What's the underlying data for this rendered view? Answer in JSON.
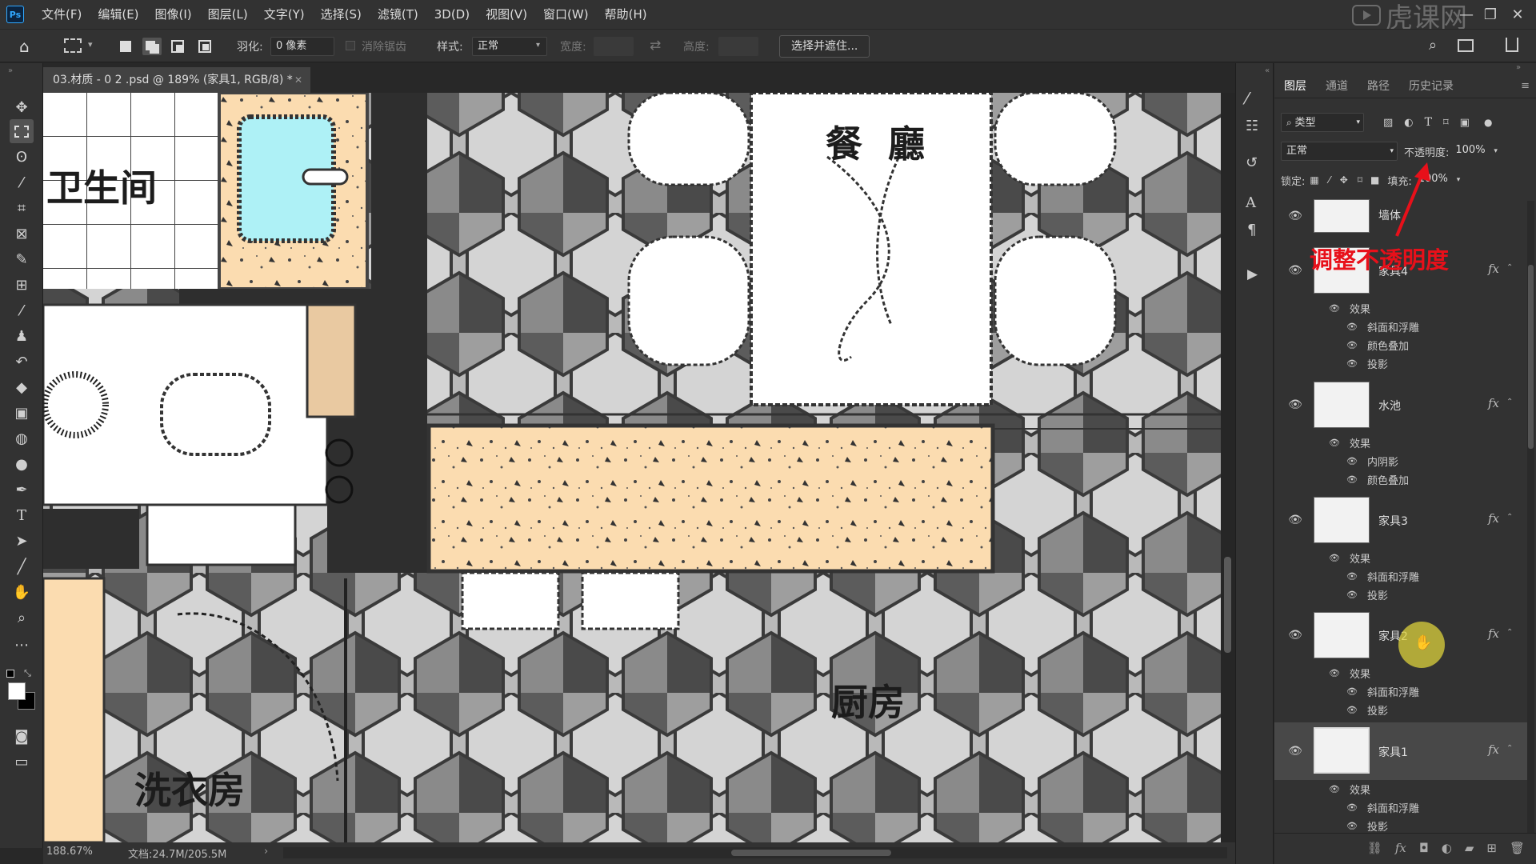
{
  "app": {
    "logo": "Ps",
    "watermark": "虎课网"
  },
  "menu": [
    "文件(F)",
    "编辑(E)",
    "图像(I)",
    "图层(L)",
    "文字(Y)",
    "选择(S)",
    "滤镜(T)",
    "3D(D)",
    "视图(V)",
    "窗口(W)",
    "帮助(H)"
  ],
  "options": {
    "feather_label": "羽化:",
    "feather_value": "0 像素",
    "antialias_label": "消除锯齿",
    "style_label": "样式:",
    "style_value": "正常",
    "width_label": "宽度:",
    "height_label": "高度:",
    "select_mask_button": "选择并遮住..."
  },
  "document": {
    "tab_title": "03.材质 - 0 2 .psd @ 189% (家具1, RGB/8) *"
  },
  "canvas_labels": {
    "bathroom": "卫生间",
    "dining": "餐  廳",
    "kitchen": "厨房",
    "laundry": "洗衣房"
  },
  "status": {
    "zoom": "188.67%",
    "doc": "文档:24.7M/205.5M"
  },
  "layers_panel": {
    "tabs": [
      "图层",
      "通道",
      "路径",
      "历史记录"
    ],
    "filter_kind": "类型",
    "blend_mode": "正常",
    "opacity_label": "不透明度:",
    "opacity_value": "100%",
    "lock_label": "锁定:",
    "fill_label": "填充:",
    "fill_value": "100%",
    "effects_label": "效果",
    "layers": [
      {
        "name": "墙体",
        "fx": "",
        "effects": []
      },
      {
        "name": "家具4",
        "fx": "fx",
        "effects": [
          "斜面和浮雕",
          "颜色叠加",
          "投影"
        ]
      },
      {
        "name": "水池",
        "fx": "fx",
        "effects": [
          "内阴影",
          "颜色叠加"
        ]
      },
      {
        "name": "家具3",
        "fx": "fx",
        "effects": [
          "斜面和浮雕",
          "投影"
        ]
      },
      {
        "name": "家具2",
        "fx": "fx",
        "effects": [
          "斜面和浮雕",
          "投影"
        ]
      },
      {
        "name": "家具1",
        "fx": "fx",
        "effects": [
          "斜面和浮雕",
          "投影"
        ]
      }
    ]
  },
  "annotation": {
    "text": "调整不透明度",
    "color": "#e8101a"
  },
  "colors": {
    "ui_bg": "#323232",
    "panel_dark": "#282828",
    "accent_blue": "#31a8ff",
    "annotation_red": "#e8101a"
  }
}
